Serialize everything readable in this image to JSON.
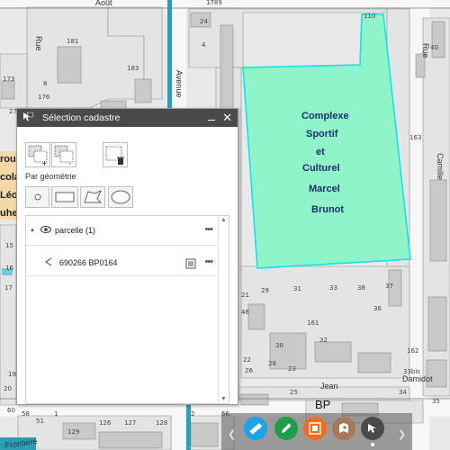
{
  "map": {
    "streets": {
      "aout": "Août",
      "rue_left": "Rue",
      "avenue": "Avenue",
      "rue_right": "Rue",
      "camille": "Camille",
      "jean": "Jean",
      "damidot": "Damidot",
      "frontiere": "Frontière"
    },
    "parcels": {
      "p1789": "1789",
      "p110": "110",
      "p181": "181",
      "p183": "183",
      "p173": "173",
      "p176": "176",
      "p163": "163",
      "p161": "161",
      "p162": "162",
      "p33bis": "33bis",
      "p34": "34",
      "p35": "35",
      "p126": "126",
      "p127": "127",
      "p128": "128",
      "p129": "129",
      "p29": "29",
      "p31": "31",
      "p33": "33",
      "p38": "38",
      "p37": "37",
      "p46": "46",
      "p36": "36",
      "p32": "32",
      "p30": "30",
      "p28": "28",
      "p26": "26",
      "p25": "25",
      "p23": "23",
      "p22": "22",
      "p21": "21",
      "p19": "19",
      "p20": "20",
      "p17": "17",
      "p16": "16",
      "p15": "15",
      "p51": "51",
      "p1": "1",
      "p2": "2",
      "p60": "60",
      "p58": "58",
      "p56": "56",
      "p40": "40",
      "p24": "24",
      "p27": "27",
      "p8": "8",
      "p4": "4"
    },
    "section": "BP",
    "complex_lines": [
      "Complexe",
      "Sportif",
      "et",
      "Culturel",
      "Marcel",
      "Brunot"
    ],
    "partial_labels": [
      "rou",
      "cola",
      "Léo",
      "uhe"
    ]
  },
  "panel": {
    "title": "Sélection cadastre",
    "section_label": "Par géométrie",
    "layer": {
      "label": "parcelle (1)"
    },
    "result": {
      "label": "690266 BP0164"
    }
  },
  "colors": {
    "selection_fill": "#8ff5c9",
    "selection_stroke": "#16e0f0",
    "header_bg": "#4a4a4a",
    "tool_blue": "#1aa3e8",
    "tool_green": "#1e9e4a",
    "tool_orange": "#f36b1c",
    "tool_brown": "#a57a5c",
    "tool_dark": "#4a4a4a"
  },
  "toolbar": {
    "icons": [
      "ruler-icon",
      "pencil-icon",
      "print-icon",
      "location-icon",
      "selection-icon"
    ]
  }
}
